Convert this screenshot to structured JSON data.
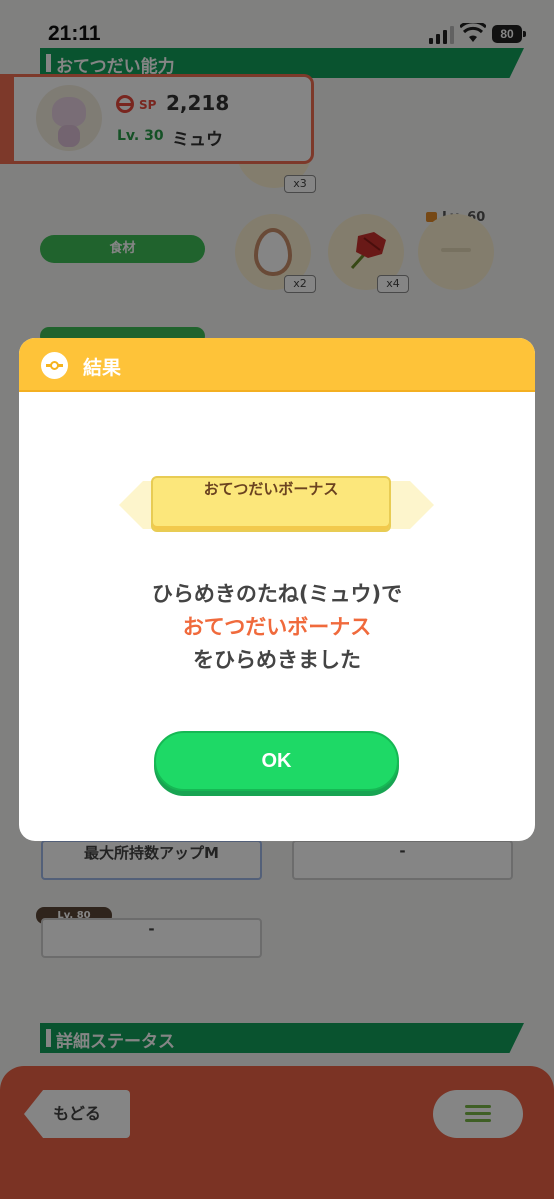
{
  "status_bar": {
    "time": "21:11",
    "battery": "80"
  },
  "sections": {
    "help_ability": "おてつだい能力",
    "detail_status": "詳細ステータス"
  },
  "pokemon": {
    "sp_label": "SP",
    "sp_value": "2,218",
    "level": "Lv. 30",
    "name": "ミュウ"
  },
  "ingredients": {
    "label": "食材",
    "top_qty": "x3",
    "items": [
      {
        "icon": "egg-icon",
        "qty": "x2"
      },
      {
        "icon": "leaf-icon",
        "qty": "x4"
      }
    ],
    "locked_level": "Lv. 60"
  },
  "skills": {
    "box1": "最大所持数アップM",
    "box2": "-",
    "box3_lock": "Lv. 80",
    "box3": "-"
  },
  "nav": {
    "back": "もどる",
    "menu_icon": "hamburger-icon"
  },
  "dialog": {
    "title": "結果",
    "badge": "おてつだいボーナス",
    "line1": "ひらめきのたね(ミュウ)で",
    "line2": "おてつだいボーナス",
    "line3": "をひらめきました",
    "ok": "OK"
  },
  "colors": {
    "accent_green": "#1ed966",
    "header_yellow": "#fec339",
    "highlight_orange": "#f06a3c"
  }
}
